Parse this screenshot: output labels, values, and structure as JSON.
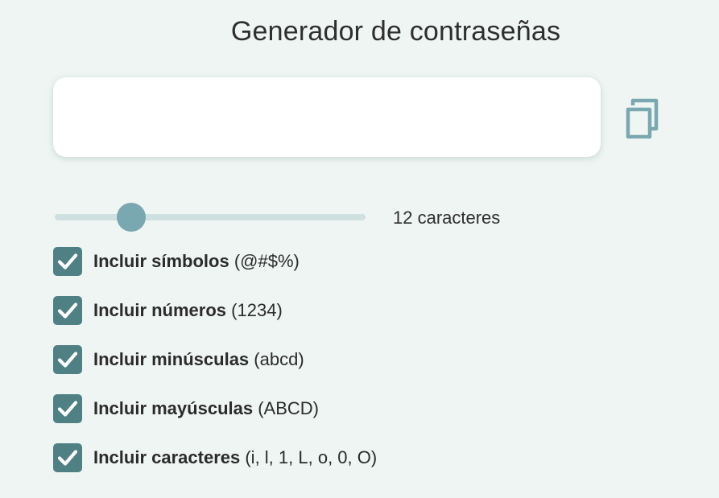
{
  "header": {
    "title": "Generador de contraseñas"
  },
  "password": {
    "value": "",
    "placeholder": ""
  },
  "copy": {
    "icon": "copy-icon",
    "color": "#7aa8b0"
  },
  "length": {
    "min": 4,
    "max": 40,
    "value": 12,
    "label": "12 caracteres"
  },
  "options": [
    {
      "label": "Incluir símbolos",
      "example": "(@#$%)",
      "checked": true
    },
    {
      "label": "Incluir números",
      "example": "(1234)",
      "checked": true
    },
    {
      "label": "Incluir minúsculas",
      "example": "(abcd)",
      "checked": true
    },
    {
      "label": "Incluir mayúsculas",
      "example": "(ABCD)",
      "checked": true
    },
    {
      "label": "Incluir caracteres",
      "example": "(i, l, 1, L, o, 0, O)",
      "checked": true
    }
  ],
  "colors": {
    "background": "#eff5f2",
    "accent": "#4f8084",
    "slider_thumb": "#7aa8b0",
    "slider_track": "#cfe0e0"
  }
}
